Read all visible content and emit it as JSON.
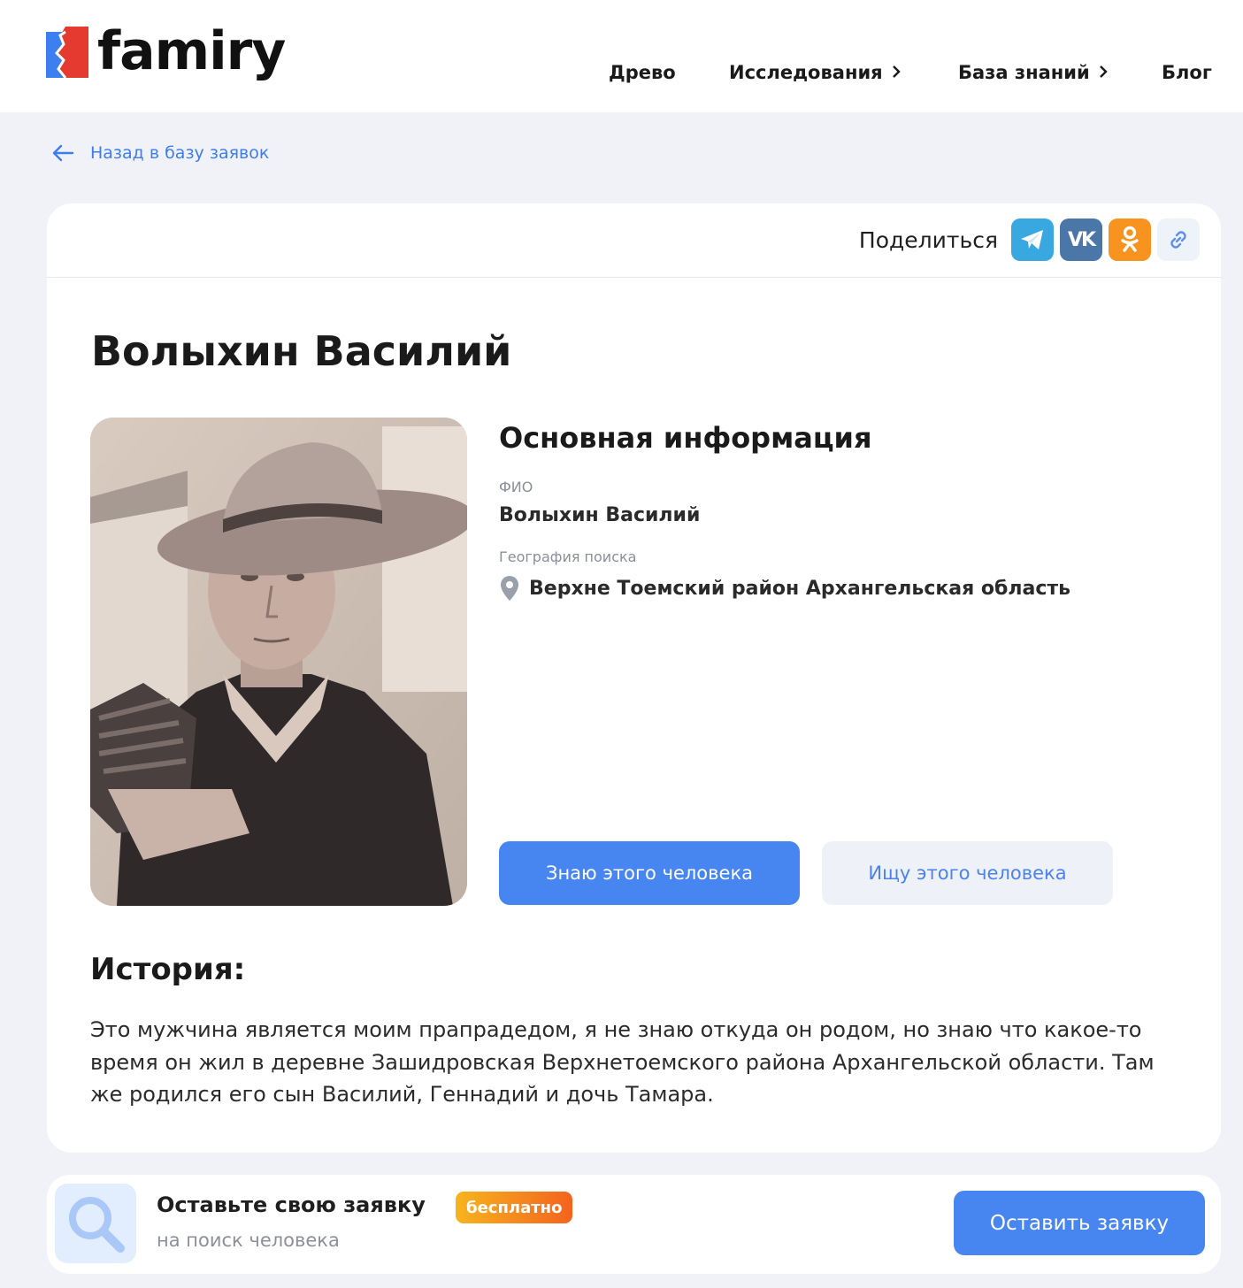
{
  "header": {
    "logo_text": "famiry",
    "nav": [
      {
        "label": "Древо",
        "has_chevron": false
      },
      {
        "label": "Исследования",
        "has_chevron": true
      },
      {
        "label": "База знаний",
        "has_chevron": true
      },
      {
        "label": "Блог",
        "has_chevron": false
      }
    ]
  },
  "back_link": {
    "label": "Назад в базу заявок",
    "icon": "arrow-left-icon"
  },
  "share": {
    "label": "Поделиться",
    "buttons": [
      {
        "name": "telegram",
        "color": "#3aa8e0",
        "icon": "telegram-icon"
      },
      {
        "name": "vk",
        "color": "#4a76a8",
        "icon": "vk-icon"
      },
      {
        "name": "ok",
        "color": "#f7931e",
        "icon": "odnoklassniki-icon"
      },
      {
        "name": "copy-link",
        "color": "#eef2f9",
        "icon": "link-icon"
      }
    ]
  },
  "person": {
    "name": "Волыхин Василий",
    "photo_icon": "portrait-photo"
  },
  "info": {
    "title": "Основная информация",
    "fio_label": "ФИО",
    "fio_value": "Волыхин Василий",
    "geo_label": "География поиска",
    "geo_value": "Верхне Тоемский район Архангельская область",
    "geo_icon": "map-pin-icon"
  },
  "actions": {
    "know_label": "Знаю этого человека",
    "search_label": "Ищу этого человека"
  },
  "history": {
    "title": "История:",
    "text": "Это мужчина является моим прапрадедом, я не знаю откуда он родом, но знаю что какое-то время он жил в деревне Зашидровская Верхнетоемского района Архангельской области. Там же родился его сын Василий, Геннадий и дочь Тамара."
  },
  "cta": {
    "title": "Оставьте свою заявку",
    "badge": "бесплатно",
    "subtitle": "на поиск человека",
    "button": "Оставить заявку",
    "icon": "magnifier-icon"
  },
  "colors": {
    "accent": "#4786f0",
    "link": "#3c7df2",
    "background": "#f1f2f7",
    "logo_red": "#e53a30",
    "logo_blue": "#3d7ef0"
  }
}
